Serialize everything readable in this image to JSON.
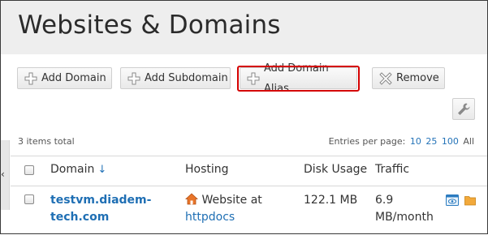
{
  "page": {
    "title": "Websites & Domains"
  },
  "toolbar": {
    "add_domain": "Add Domain",
    "add_subdomain": "Add Subdomain",
    "add_domain_alias": "Add Domain Alias",
    "remove": "Remove"
  },
  "list": {
    "items_total": "3 items total",
    "entries_label": "Entries per page:",
    "entries_options": [
      "10",
      "25",
      "100",
      "All"
    ]
  },
  "table": {
    "columns": {
      "domain": "Domain",
      "hosting": "Hosting",
      "disk_usage": "Disk Usage",
      "traffic": "Traffic"
    },
    "sort_indicator": "↓",
    "rows": [
      {
        "domain_line1": "testvm.diadem-",
        "domain_line2": "tech.com",
        "hosting_text": "Website at",
        "hosting_link": "httpdocs",
        "disk_usage": "122.1 MB",
        "traffic_line1": "6.9",
        "traffic_line2": "MB/month"
      }
    ]
  },
  "side_panel": {
    "arrow": "‹"
  },
  "icons": [
    "plus-icon",
    "remove-icon",
    "wrench-icon",
    "home-icon",
    "preview-icon",
    "folder-icon"
  ],
  "colors": {
    "link": "#1f6fb4",
    "highlight_border": "#d40000",
    "header_bg": "#eeeeee"
  }
}
